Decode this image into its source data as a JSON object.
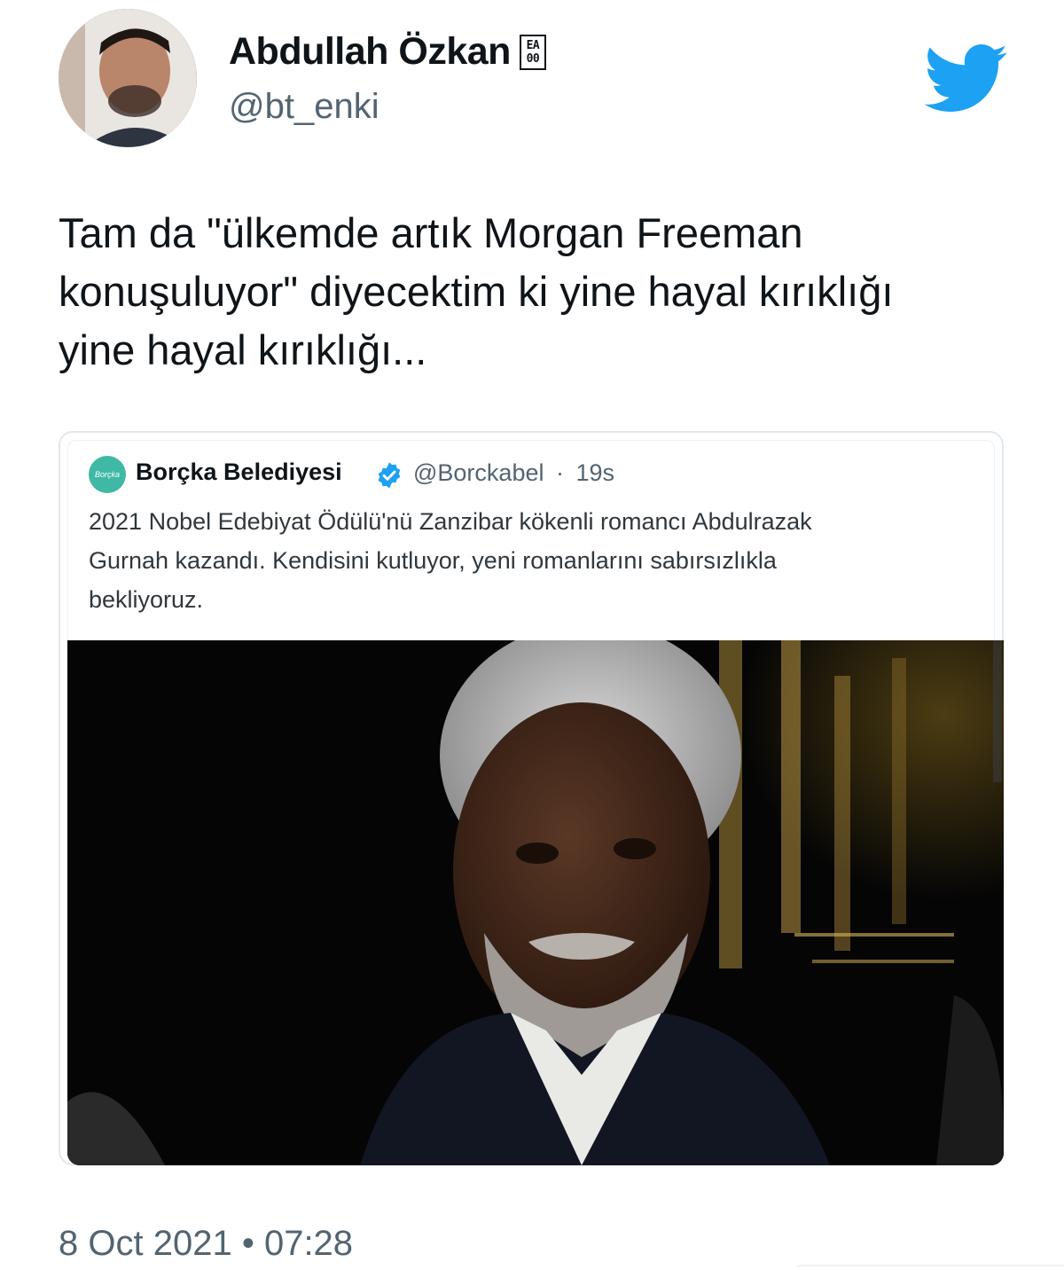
{
  "author": {
    "display_name": "Abdullah Özkan",
    "badge_top": "EA",
    "badge_bottom": "00",
    "handle": "@bt_enki"
  },
  "tweet": {
    "text_lines": [
      "Tam da \"ülkemde artık Morgan Freeman",
      "konuşuluyor\" diyecektim ki yine hayal kırıklığı",
      "yine hayal kırıklığı..."
    ],
    "date": "8 Oct 2021",
    "separator": "•",
    "time": "07:28"
  },
  "quoted_tweet": {
    "avatar_text": "Borçka",
    "display_name": "Borçka Belediyesi",
    "handle": "@Borckabel",
    "separator": "·",
    "age": "19s",
    "text_lines": [
      "2021 Nobel Edebiyat Ödülü'nü Zanzibar kökenli romancı Abdulrazak",
      "Gurnah kazandı. Kendisini kutluyor, yeni romanlarını sabırsızlıkla",
      "bekliyoruz."
    ]
  },
  "icons": {
    "brand": "twitter-bird-icon",
    "verified": "verified-badge-icon"
  },
  "colors": {
    "twitter_blue": "#1da1f2",
    "secondary_text": "#536471",
    "card_border": "#e1e8ed",
    "quote_avatar": "#3fb8a6"
  }
}
